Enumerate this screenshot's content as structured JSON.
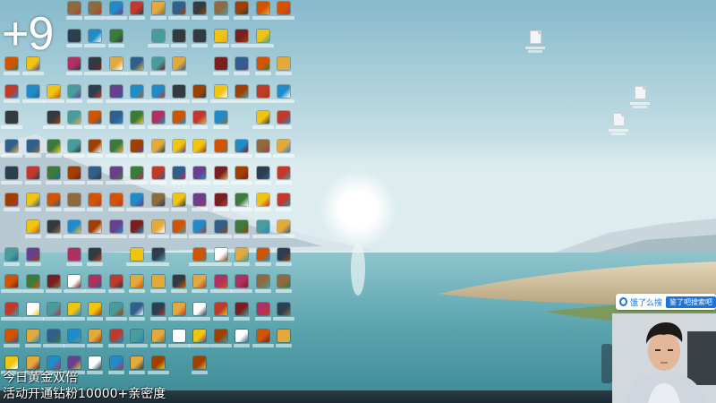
{
  "overlay": {
    "counter": "+9",
    "promo_line1": "今日黄金双倍",
    "promo_line2": "活动开通钻粉10000+亲密度"
  },
  "search_bar": {
    "query": "饿了么搜",
    "button": "鉴了吧搜索吧"
  },
  "colors": {
    "sky_top": "#8fbfcf",
    "sky_mid": "#bfdbe2",
    "sea": "#5ea8b3",
    "sand": "#d8c9a8",
    "accent": "#1e74d6"
  },
  "desktop": {
    "icon_palette": [
      "#2f5f8a",
      "#c0392b",
      "#e5a93b",
      "#3b7a3b",
      "#6a3f8e",
      "#d35400",
      "#1f8bc9",
      "#333a40",
      "#8e6b3e",
      "#b03060",
      "#4a9c9c",
      "#f1c40f",
      "#ffffff",
      "#7a1f1f",
      "#2c3e50",
      "#a04000"
    ],
    "right_files": 3
  }
}
